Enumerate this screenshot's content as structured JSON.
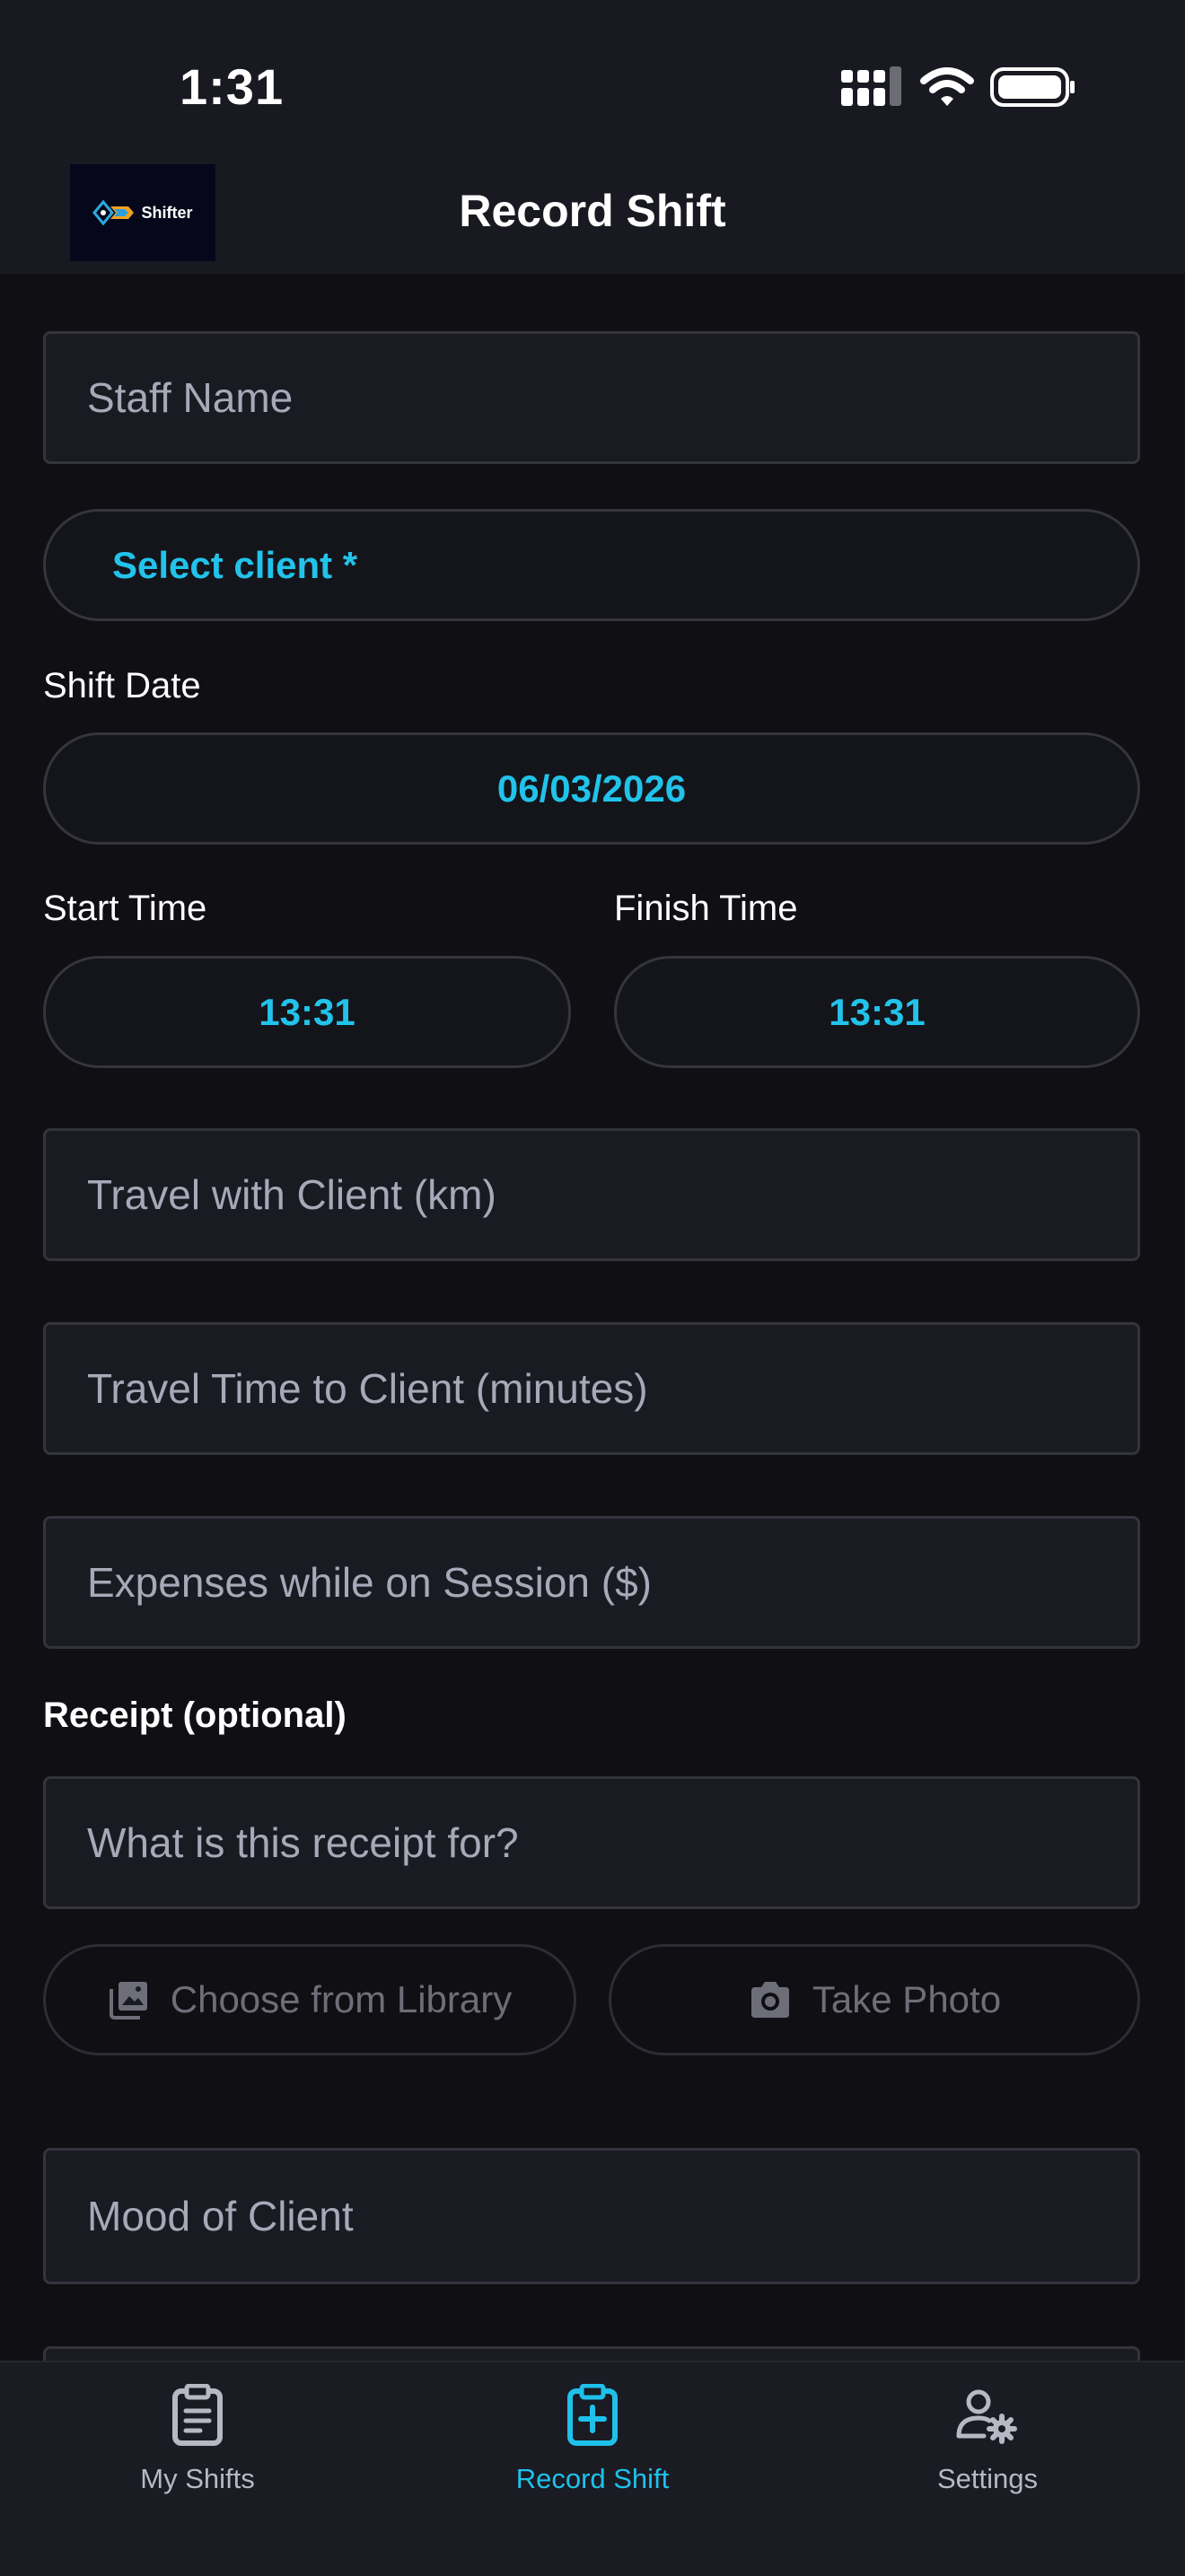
{
  "status_bar": {
    "time": "1:31",
    "icons": [
      "cellular-signal-icon",
      "wifi-icon",
      "battery-icon"
    ]
  },
  "header": {
    "logo_text": "Shifter",
    "title": "Record Shift"
  },
  "form": {
    "staff_name": {
      "placeholder": "Staff Name"
    },
    "select_client": {
      "label": "Select client *"
    },
    "shift_date": {
      "label": "Shift Date",
      "value": "06/03/2026"
    },
    "start_time": {
      "label": "Start Time",
      "value": "13:31"
    },
    "finish_time": {
      "label": "Finish Time",
      "value": "13:31"
    },
    "travel_km": {
      "placeholder": "Travel with Client (km)"
    },
    "travel_time": {
      "placeholder": "Travel Time to Client (minutes)"
    },
    "expenses": {
      "placeholder": "Expenses while on Session ($)"
    },
    "receipt": {
      "heading": "Receipt (optional)",
      "description_placeholder": "What is this receipt for?",
      "choose_library_label": "Choose from Library",
      "take_photo_label": "Take Photo"
    },
    "mood": {
      "placeholder": "Mood of Client"
    }
  },
  "tab_bar": {
    "tabs": [
      {
        "label": "My Shifts",
        "icon": "clipboard-list-icon",
        "active": false
      },
      {
        "label": "Record Shift",
        "icon": "clipboard-plus-icon",
        "active": true
      },
      {
        "label": "Settings",
        "icon": "user-gear-icon",
        "active": false
      }
    ]
  },
  "colors": {
    "accent": "#1fc1ea",
    "background": "#0f0f14",
    "surface": "#191a22"
  }
}
